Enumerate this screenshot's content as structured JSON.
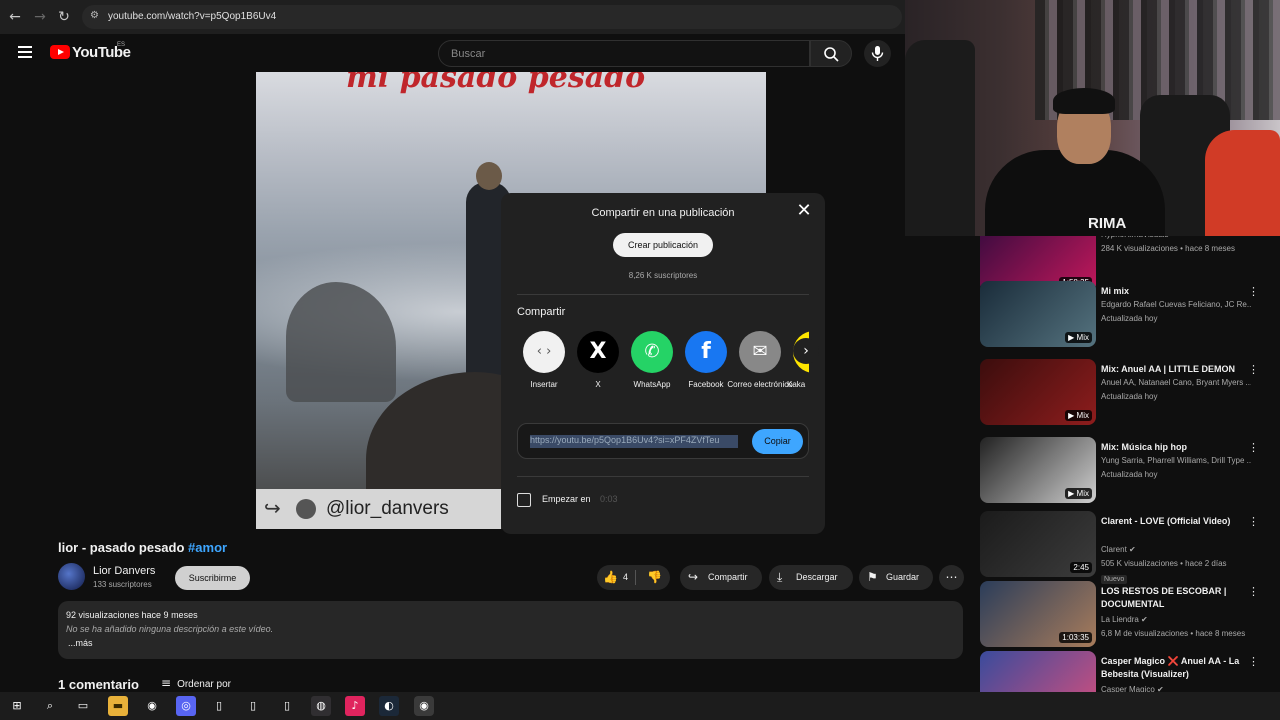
{
  "browser": {
    "url": "youtube.com/watch?v=p5Qop1B6Uv4"
  },
  "header": {
    "logo_text": "YouTube",
    "region": "ES",
    "search_placeholder": "Buscar"
  },
  "video": {
    "overlay_title": "mi pasado pesado",
    "watermark_handle": "@lior_danvers"
  },
  "share_dialog": {
    "title": "Compartir en una publicación",
    "create_post": "Crear publicación",
    "subscribers": "8,26 K suscriptores",
    "share_label": "Compartir",
    "targets": [
      {
        "name": "Insertar",
        "icon": "embed-icon",
        "bg": "#f1f1f1",
        "fg": "#555555",
        "glyph": "‹ ›"
      },
      {
        "name": "X",
        "icon": "x-icon",
        "bg": "#000000",
        "fg": "#ffffff",
        "glyph": "𝕏"
      },
      {
        "name": "WhatsApp",
        "icon": "whatsapp-icon",
        "bg": "#25d366",
        "fg": "#ffffff",
        "glyph": "✆"
      },
      {
        "name": "Facebook",
        "icon": "facebook-icon",
        "bg": "#1877f2",
        "fg": "#ffffff",
        "glyph": "f"
      },
      {
        "name": "Correo electrónico",
        "icon": "email-icon",
        "bg": "#888888",
        "fg": "#ffffff",
        "glyph": "✉"
      },
      {
        "name": "Kaka",
        "icon": "kakao-icon",
        "bg": "#fee500",
        "fg": "#000000",
        "glyph": ""
      }
    ],
    "link": "https://youtu.be/p5Qop1B6Uv4?si=xPF4ZVfTeu",
    "copy": "Copiar",
    "start_at": "Empezar en",
    "start_time": "0:03"
  },
  "watch": {
    "title": "lior - pasado pesado",
    "hashtag": "#amor",
    "channel_name": "Lior Danvers",
    "channel_subs": "133 suscriptores",
    "subscribe": "Suscribirme",
    "likes": "4",
    "share": "Compartir",
    "download": "Descargar",
    "save": "Guardar",
    "stats": "92 visualizaciones  hace 9 meses",
    "description": "No se ha añadido ninguna descripción a este vídeo.",
    "more": "...más",
    "comments": "1 comentario",
    "sort": "Ordenar por"
  },
  "webcam": {
    "shirt_text": "RIMA"
  },
  "recommendations": [
    {
      "title": "",
      "line1": "HypnoRimaVisuals",
      "line2": "284 K visualizaciones • hace 8 meses",
      "time": "1:58:35",
      "badge": "",
      "colors": [
        "#3a0b3f",
        "#c2185b"
      ]
    },
    {
      "title": "Mi mix",
      "line1": "Edgardo Rafael Cuevas Feliciano, JC Re...",
      "line2": "Actualizada hoy",
      "time": "▶ Mix",
      "badge": "",
      "colors": [
        "#1a2c3a",
        "#55737f"
      ]
    },
    {
      "title": "Mix: Anuel AA | LITTLE DEMON",
      "line1": "Anuel AA, Natanael Cano, Bryant Myers ...",
      "line2": "Actualizada hoy",
      "time": "▶ Mix",
      "badge": "",
      "colors": [
        "#3b0d0d",
        "#8e1d1d"
      ]
    },
    {
      "title": "Mix: Música hip hop",
      "line1": "Yung Sarria, Pharrell Williams, Drill Type ...",
      "line2": "Actualizada hoy",
      "time": "▶ Mix",
      "badge": "",
      "colors": [
        "#222222",
        "#cfcfcf"
      ]
    },
    {
      "title": "Clarent - LOVE (Official Video)",
      "line1": "Clarent ✔",
      "line2": "505 K visualizaciones • hace 2 días",
      "time": "2:45",
      "badge": "Nuevo",
      "colors": [
        "#1b1b1b",
        "#3c3c3c"
      ]
    },
    {
      "title": "LOS RESTOS DE ESCOBAR | DOCUMENTAL",
      "line1": "La Liendra ✔",
      "line2": "6,8 M de visualizaciones • hace 8 meses",
      "time": "1:03:35",
      "badge": "",
      "colors": [
        "#2b3d5a",
        "#a87c5b"
      ]
    },
    {
      "title": "Casper Magico ❌ Anuel AA - La Bebesita (Visualizer)",
      "line1": "Casper Magico ✔",
      "line2": "",
      "time": "",
      "badge": "",
      "colors": [
        "#3a4b9c",
        "#d14f7e"
      ]
    }
  ],
  "taskbar": {
    "icons": [
      "windows-icon",
      "search-icon",
      "task-view-icon",
      "file-explorer-icon",
      "chrome-icon",
      "discord-icon",
      "document-icon",
      "document-icon",
      "document-icon",
      "obs-icon",
      "tiktok-icon",
      "steam-icon",
      "chrome-icon"
    ]
  }
}
